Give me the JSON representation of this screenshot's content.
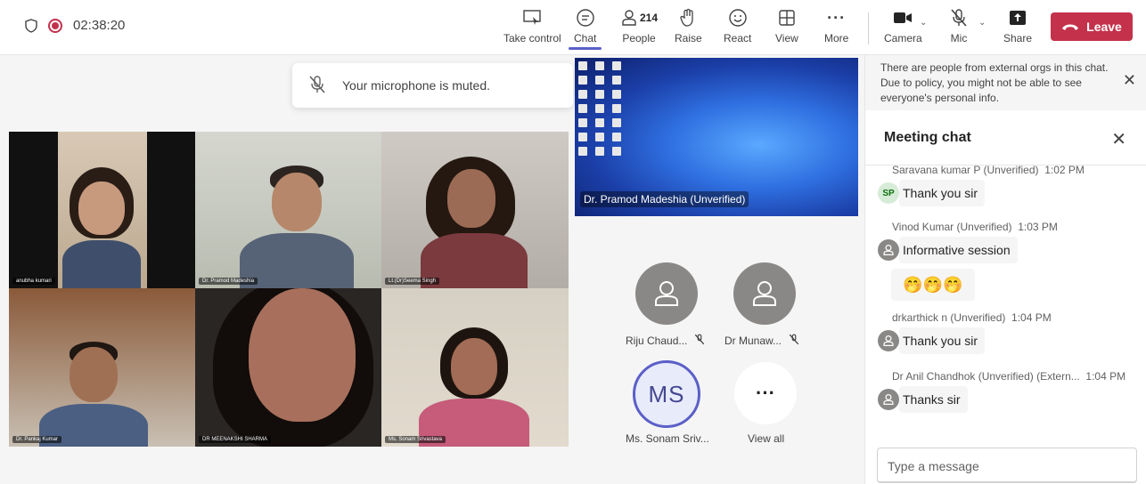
{
  "meeting": {
    "timer": "02:38:20"
  },
  "toolbar": {
    "take_control": "Take control",
    "chat": "Chat",
    "people": "People",
    "people_count": "214",
    "raise": "Raise",
    "react": "React",
    "view": "View",
    "more": "More",
    "camera": "Camera",
    "mic": "Mic",
    "share": "Share",
    "leave": "Leave"
  },
  "toast": {
    "text": "Your microphone is muted."
  },
  "tiles": [
    {
      "name": "anubha kumari"
    },
    {
      "name": "Dr. Pramod Madeshia"
    },
    {
      "name": "Lt.(Dr)Seema Singh"
    },
    {
      "name": "Dr. Pankaj Kumar"
    },
    {
      "name": "DR MEENAKSHI SHARMA"
    },
    {
      "name": "Ms. Sonam Srivastava"
    }
  ],
  "screenshare": {
    "label": "Dr. Pramod Madeshia (Unverified)"
  },
  "avatars": [
    {
      "name": "Riju Chaud..."
    },
    {
      "name": "Dr Munaw..."
    },
    {
      "initials": "MS",
      "name": "Ms. Sonam Sriv..."
    },
    {
      "name": "View all"
    }
  ],
  "panel": {
    "notice": "There are people from external orgs in this chat. Due to policy, you might not be able to see everyone's personal info.",
    "title": "Meeting chat",
    "composer_placeholder": "Type a message",
    "messages": [
      {
        "author": "Saravana kumar P (Unverified)",
        "time": "1:02 PM",
        "text": "Thank you sir",
        "avatar": "SP"
      },
      {
        "author": "Vinod Kumar (Unverified)",
        "time": "1:03 PM",
        "text": "Informative session",
        "avatar": ""
      },
      {
        "author": "drkarthick n (Unverified)",
        "time": "1:04 PM",
        "text": "Thank you sir",
        "avatar": ""
      },
      {
        "author": "Dr Anil Chandhok (Unverified) (Extern...",
        "time": "1:04 PM",
        "text": "Thanks sir",
        "avatar": ""
      }
    ],
    "reactions": "🤭🤭🤭"
  },
  "colors": {
    "accent": "#5b5fc7",
    "leave": "#c4314b"
  }
}
